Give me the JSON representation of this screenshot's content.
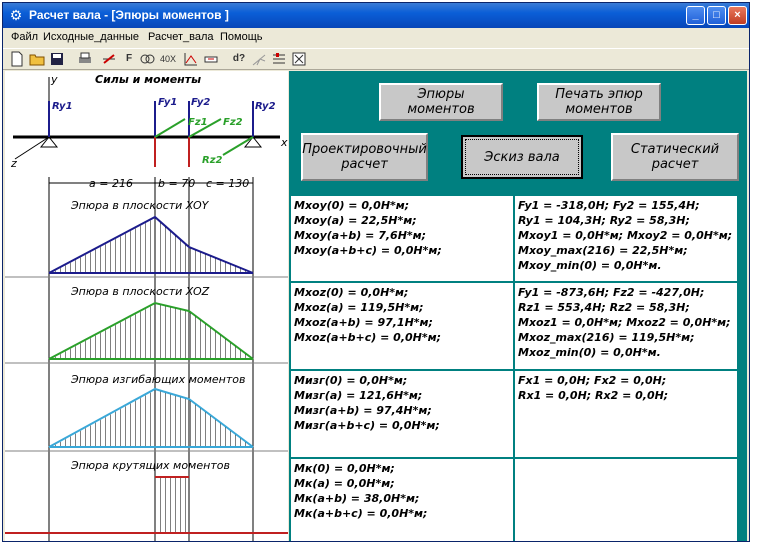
{
  "window": {
    "title": "Расчет вала - [Эпюры моментов ]",
    "controls": [
      "_",
      "□",
      "×"
    ]
  },
  "menu": [
    "Файл",
    "Исходные_данные",
    "Расчет_вала",
    "Помощь"
  ],
  "toolbar": [
    "new-icon",
    "open-icon",
    "save-icon",
    "print-icon",
    "strike-icon",
    "force-icon",
    "link-icon",
    "zoom-icon",
    "chart-icon",
    "key-icon",
    "d-help-icon",
    "shaft-icon",
    "settings-icon",
    "close-box-icon"
  ],
  "toolbar_text": {
    "zoom": "40X",
    "force": "F",
    "help": "d?"
  },
  "scheme": {
    "title": "Силы и моменты",
    "axis_y": "y",
    "axis_x": "x",
    "axis_z": "z",
    "force_labels": {
      "ry1": "Ry1",
      "fy1": "Fy1",
      "fy2": "Fy2",
      "ry2": "Ry2",
      "fz1": "Fz1",
      "fz2": "Fz2",
      "rz2": "Rz2"
    },
    "dims": {
      "a": "a = 216",
      "b": "b = 70",
      "c": "c = 130"
    }
  },
  "diagrams": {
    "xoy": "Эпюра в плоскости XOY",
    "xoz": "Эпюра в плоскости XOZ",
    "bend": "Эпюра изгибающих моментов",
    "torque": "Эпюра крутящих моментов"
  },
  "buttons": {
    "epures": "Эпюры\nмоментов",
    "print": "Печать эпюр\nмоментов",
    "design": "Проектировочный\nрасчет",
    "sketch": "Эскиз вала",
    "static": "Статический\nрасчет"
  },
  "results": {
    "xoy_moments": [
      "Мxoy(0) = 0,0Н*м;",
      "Мxoy(a) = 22,5Н*м;",
      "Мxoy(a+b) = 7,6Н*м;",
      "Мxoy(a+b+c) = 0,0Н*м;"
    ],
    "xoy_forces": [
      "Fy1 = -318,0Н; Fy2 = 155,4Н;",
      "Ry1 = 104,3Н; Ry2 = 58,3Н;",
      "Мxoy1 = 0,0Н*м; Мxoy2 = 0,0Н*м;",
      "Мxoy_max(216) = 22,5Н*м;",
      "Мxoy_min(0) = 0,0Н*м."
    ],
    "xoz_moments": [
      "Мxoz(0) = 0,0Н*м;",
      "Мxoz(a) = 119,5Н*м;",
      "Мxoz(a+b) = 97,1Н*м;",
      "Мxoz(a+b+c) = 0,0Н*м;"
    ],
    "xoz_forces": [
      "Fy1 = -873,6Н; Fz2 = -427,0Н;",
      "Rz1 = 553,4Н; Rz2 = 58,3Н;",
      "Мxoz1 = 0,0Н*м; Мxoz2 = 0,0Н*м;",
      "Мxoz_max(216) = 119,5Н*м;",
      "Мxoz_min(0) = 0,0Н*м."
    ],
    "bend_moments": [
      "Мизг(0) = 0,0Н*м;",
      "Мизг(a) = 121,6Н*м;",
      "Мизг(a+b) = 97,4Н*м;",
      "Мизг(a+b+c) = 0,0Н*м;"
    ],
    "bend_forces": [
      "Fx1 = 0,0Н; Fx2 = 0,0Н;",
      "Rx1 = 0,0Н; Rx2 = 0,0Н;"
    ],
    "torque_moments": [
      "Мк(0) = 0,0Н*м;",
      "Мк(a) = 0,0Н*м;",
      "Мк(a+b) = 38,0Н*м;",
      "Мк(a+b+c) = 0,0Н*м;"
    ],
    "torque_forces": []
  },
  "colors": {
    "xoy": "#1c1c8c",
    "xoz": "#2aa02a",
    "bend": "#3aa8d8",
    "torque": "#c02020",
    "panel": "#008080"
  }
}
